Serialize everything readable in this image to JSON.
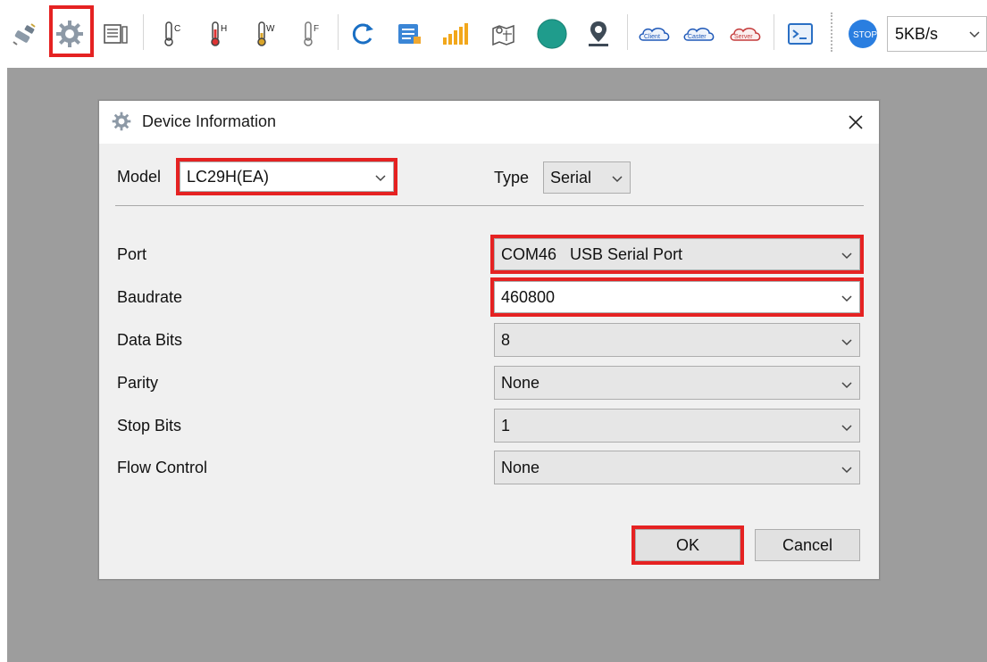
{
  "toolbar": {
    "speed": "5KB/s",
    "icons": [
      {
        "name": "connect-plug-icon"
      },
      {
        "name": "settings-gear-icon"
      },
      {
        "name": "document-icon"
      },
      {
        "name": "thermometer-c-icon",
        "letter": "C"
      },
      {
        "name": "thermometer-h-icon",
        "letter": "H"
      },
      {
        "name": "thermometer-w-icon",
        "letter": "W"
      },
      {
        "name": "thermometer-f-icon",
        "letter": "F"
      },
      {
        "name": "refresh-icon"
      },
      {
        "name": "list-icon"
      },
      {
        "name": "signal-bars-icon"
      },
      {
        "name": "map-icon"
      },
      {
        "name": "globe-icon"
      },
      {
        "name": "location-pin-icon"
      },
      {
        "name": "cloud-client-icon",
        "label": "Client"
      },
      {
        "name": "cloud-caster-icon",
        "label": "Caster"
      },
      {
        "name": "cloud-server-icon",
        "label": "Server"
      },
      {
        "name": "console-icon"
      },
      {
        "name": "stop-icon",
        "label": "STOP"
      }
    ],
    "accent": "#e52222"
  },
  "dialog": {
    "title": "Device Information",
    "model_label": "Model",
    "model_value": "LC29H(EA)",
    "type_label": "Type",
    "type_value": "Serial",
    "fields": [
      {
        "label": "Port",
        "value": "COM46   USB Serial Port"
      },
      {
        "label": "Baudrate",
        "value": "460800"
      },
      {
        "label": "Data Bits",
        "value": "8"
      },
      {
        "label": "Parity",
        "value": "None"
      },
      {
        "label": "Stop Bits",
        "value": "1"
      },
      {
        "label": "Flow Control",
        "value": "None"
      }
    ],
    "ok_label": "OK",
    "cancel_label": "Cancel"
  }
}
